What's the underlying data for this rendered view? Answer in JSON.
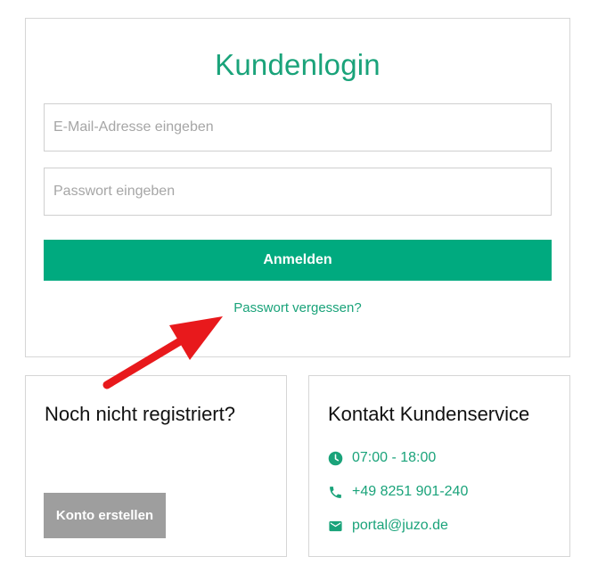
{
  "login": {
    "title": "Kundenlogin",
    "email_placeholder": "E-Mail-Adresse eingeben",
    "password_placeholder": "Passwort eingeben",
    "submit_label": "Anmelden",
    "forgot_label": "Passwort vergessen?"
  },
  "register": {
    "heading": "Noch nicht registriert?",
    "button_label": "Konto erstellen"
  },
  "contact": {
    "heading": "Kontakt Kundenservice",
    "hours": "07:00 - 18:00",
    "phone": "+49 8251 901-240",
    "email": "portal@juzo.de"
  },
  "colors": {
    "accent": "#00aa7f",
    "accent_text": "#1aa37a",
    "secondary_button": "#9e9e9e",
    "annotation_arrow": "#e8191c"
  },
  "icons": {
    "hours": "clock-icon",
    "phone": "phone-icon",
    "email": "mail-icon"
  }
}
